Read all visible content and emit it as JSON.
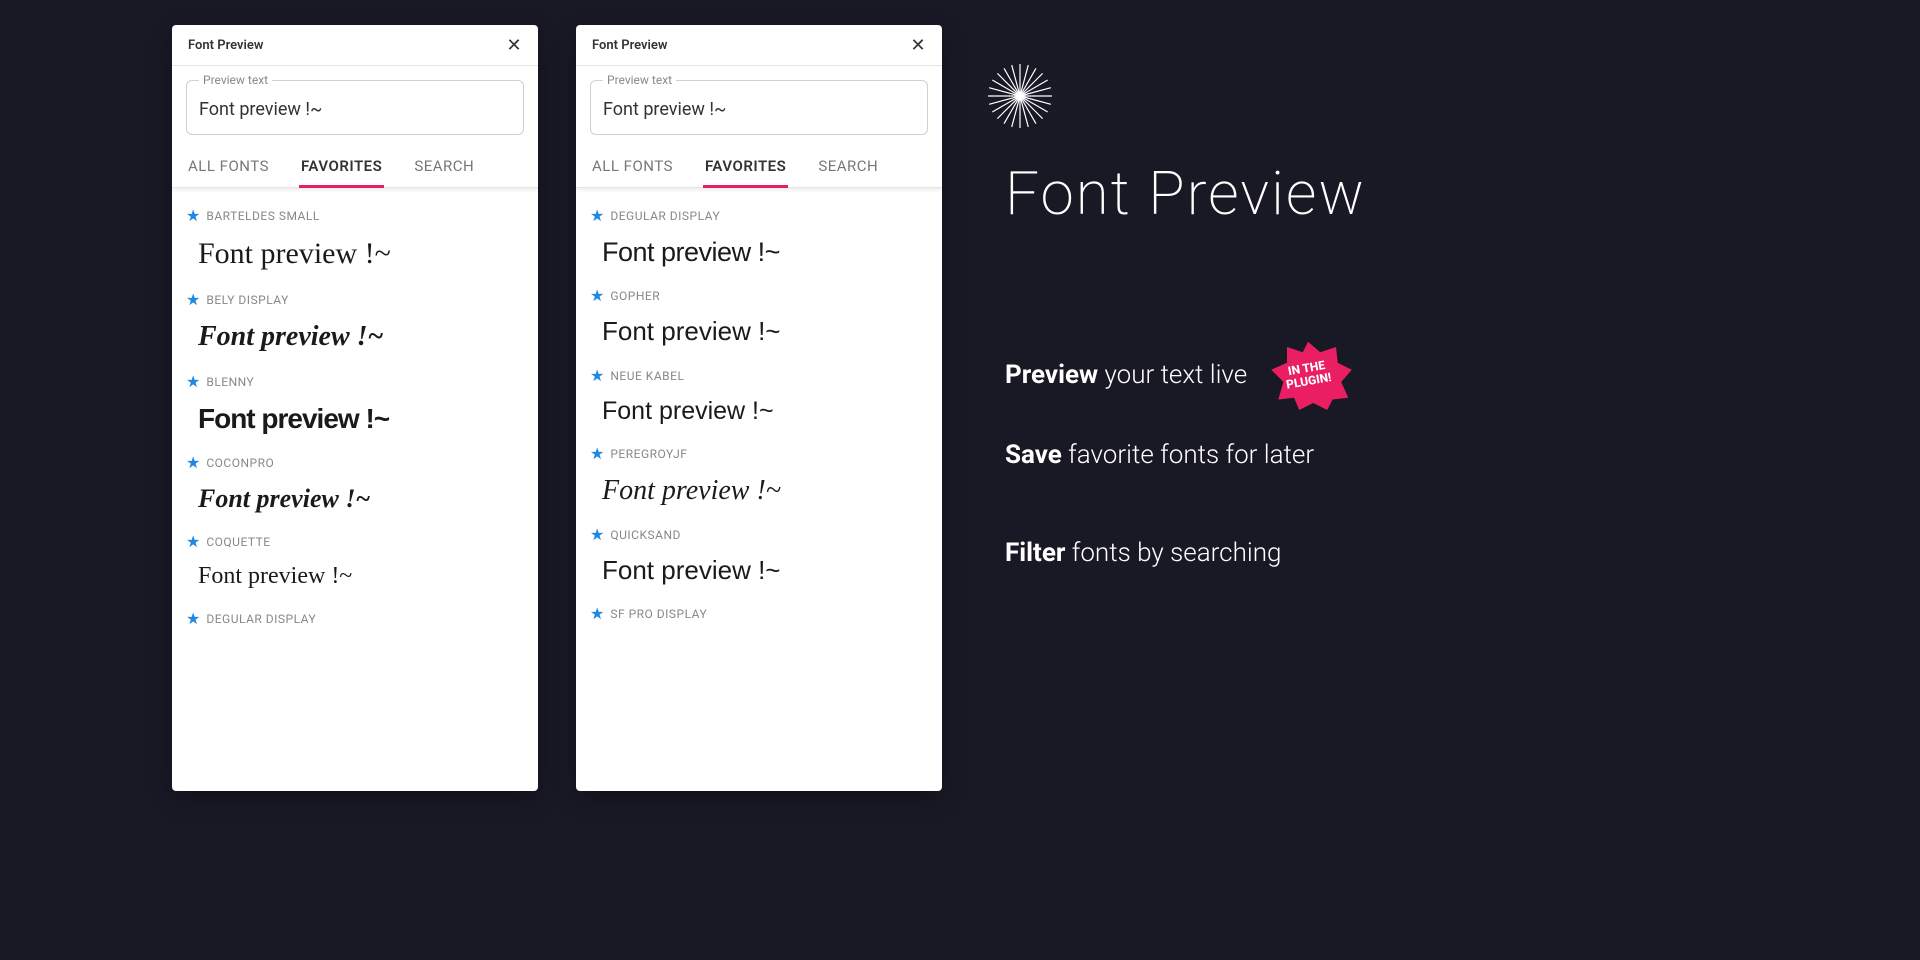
{
  "panel": {
    "title": "Font Preview",
    "preview_label": "Preview text",
    "preview_value": "Font preview !~",
    "tabs": {
      "all": "ALL FONTS",
      "favorites": "FAVORITES",
      "search": "SEARCH"
    }
  },
  "sample": "Font preview !~",
  "fonts_left": [
    {
      "name": "BARTELDES SMALL",
      "cls": "f-barteldes"
    },
    {
      "name": "BELY DISPLAY",
      "cls": "f-bely"
    },
    {
      "name": "BLENNY",
      "cls": "f-blenny"
    },
    {
      "name": "COCONPRO",
      "cls": "f-coconpro"
    },
    {
      "name": "COQUETTE",
      "cls": "f-coquette"
    },
    {
      "name": "DEGULAR DISPLAY",
      "cls": "f-degular"
    }
  ],
  "fonts_right": [
    {
      "name": "DEGULAR DISPLAY",
      "cls": "f-degular"
    },
    {
      "name": "GOPHER",
      "cls": "f-gopher"
    },
    {
      "name": "NEUE KABEL",
      "cls": "f-neue"
    },
    {
      "name": "PEREGROYJF",
      "cls": "f-peregroy"
    },
    {
      "name": "QUICKSAND",
      "cls": "f-quicksand"
    },
    {
      "name": "SF PRO DISPLAY",
      "cls": "f-degular"
    }
  ],
  "hero": {
    "title": "Font Preview"
  },
  "features": {
    "f1_bold": "Preview",
    "f1_rest": " your text live",
    "f2_bold": "Save",
    "f2_rest": " favorite fonts for later",
    "f3_bold": "Filter",
    "f3_rest": " fonts by searching"
  },
  "badge": {
    "line1": "IN THE",
    "line2": "PLUGIN!"
  }
}
